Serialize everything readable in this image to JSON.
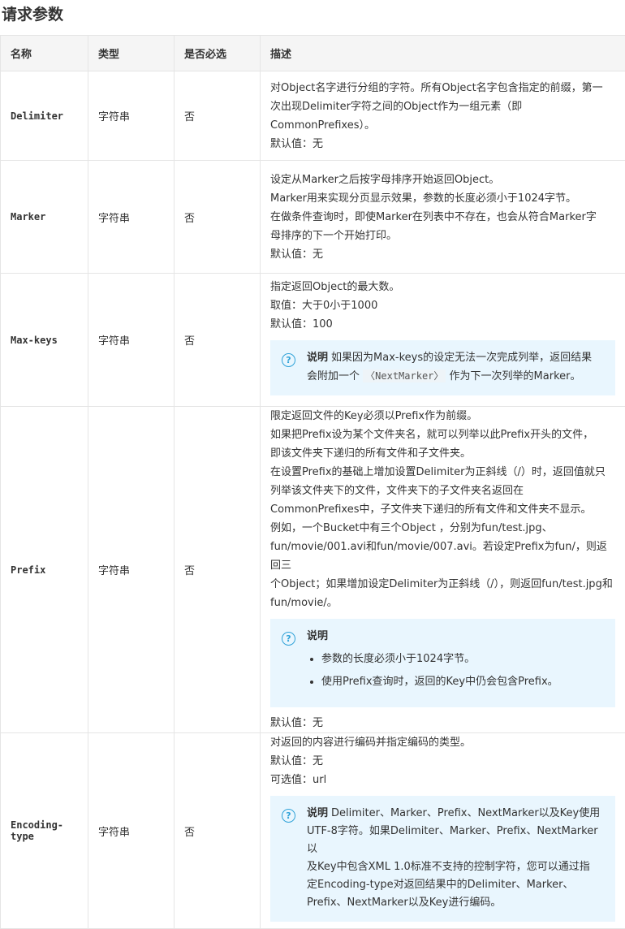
{
  "title": "请求参数",
  "table": {
    "headers": [
      "名称",
      "类型",
      "是否必选",
      "描述"
    ],
    "rows": [
      {
        "name": "Delimiter",
        "type": "字符串",
        "required": "否",
        "desc": [
          "对Object名字进行分组的字符。所有Object名字包含指定的前缀，第一",
          "次出现Delimiter字符之间的Object作为一组元素（即",
          "CommonPrefixes）。",
          "默认值：无"
        ]
      },
      {
        "name": "Marker",
        "type": "字符串",
        "required": "否",
        "desc": [
          "设定从Marker之后按字母排序开始返回Object。",
          "Marker用来实现分页显示效果，参数的长度必须小于1024字节。",
          "在做条件查询时，即使Marker在列表中不存在，也会从符合Marker字",
          "母排序的下一个开始打印。",
          "默认值：无"
        ]
      },
      {
        "name": "Max-keys",
        "type": "字符串",
        "required": "否",
        "desc": [
          "指定返回Object的最大数。",
          "取值：大于0小于1000",
          "默认值：100"
        ],
        "note": {
          "label": "说明",
          "text1": "如果因为Max-keys的设定无法一次完成列举，返回结果",
          "text2a": "会附加一个",
          "code": "〈NextMarker〉",
          "text2b": "作为下一次列举的Marker。"
        }
      },
      {
        "name": "Prefix",
        "type": "字符串",
        "required": "否",
        "desc": [
          "限定返回文件的Key必须以Prefix作为前缀。",
          "如果把Prefix设为某个文件夹名，就可以列举以此Prefix开头的文件，",
          "即该文件夹下递归的所有文件和子文件夹。",
          "在设置Prefix的基础上增加设置Delimiter为正斜线（/）时，返回值就只",
          "列举该文件夹下的文件，文件夹下的子文件夹名返回在",
          "CommonPrefixes中，子文件夹下递归的所有文件和文件夹不显示。",
          "例如，一个Bucket中有三个Object ，分别为fun/test.jpg、",
          "fun/movie/001.avi和fun/movie/007.avi。若设定Prefix为fun/，则返回三",
          "个Object；如果增加设定Delimiter为正斜线（/），则返回fun/test.jpg和",
          "fun/movie/。"
        ],
        "note": {
          "label": "说明",
          "items": [
            "参数的长度必须小于1024字节。",
            "使用Prefix查询时，返回的Key中仍会包含Prefix。"
          ]
        },
        "desc_after": "默认值：无"
      },
      {
        "name": "Encoding-type",
        "name_lines": [
          "Encoding-",
          "type"
        ],
        "type": "字符串",
        "required": "否",
        "desc": [
          "对返回的内容进行编码并指定编码的类型。",
          "默认值：无",
          "可选值：url"
        ],
        "note": {
          "label": "说明",
          "lines": [
            "Delimiter、Marker、Prefix、NextMarker以及Key使用",
            "UTF-8字符。如果Delimiter、Marker、Prefix、NextMarker以",
            "及Key中包含XML 1.0标准不支持的控制字符，您可以通过指",
            "定Encoding-type对返回结果中的Delimiter、Marker、",
            "Prefix、NextMarker以及Key进行编码。"
          ]
        }
      }
    ]
  }
}
